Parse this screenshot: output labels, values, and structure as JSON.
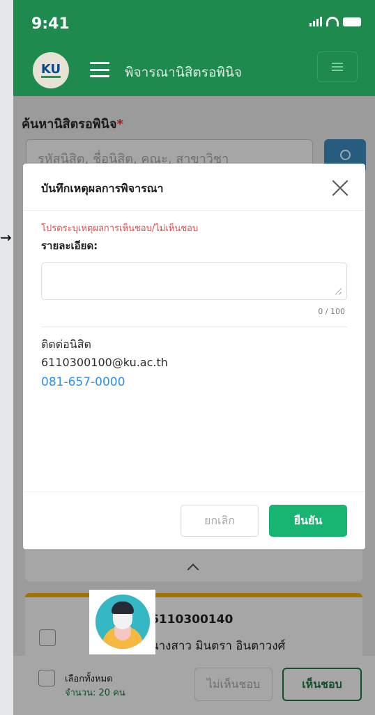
{
  "status_bar": {
    "time": "9:41"
  },
  "app_bar": {
    "logo_text": "KU",
    "title": "พิจารณานิสิตรอพินิจ"
  },
  "search": {
    "label": "ค้นหานิสิตรอพินิจ",
    "required_mark": "*",
    "placeholder": "รหัสนิสิต, ชื่อนิสิต, คณะ, สาขาวิชา"
  },
  "student": {
    "id": "6110300140",
    "name": "นางสาว มินตรา อินตาวงศ์"
  },
  "bottom_bar": {
    "select_all": "เลือกทั้งหมด",
    "count": "จำนวน: 20 คน",
    "reject_label": "ไม่เห็นชอบ",
    "accept_label": "เห็นชอบ"
  },
  "modal": {
    "title": "บันทึกเหตุผลการพิจารณา",
    "hint": "โปรดระบุเหตุผลการเห็นชอบ/ไม่เห็นชอบ",
    "detail_label": "รายละเอียด:",
    "char_count": "0 / 100",
    "contact_label": "ติดต่อนิสิต",
    "email": "6110300100@ku.ac.th",
    "phone": "081-657-0000",
    "cancel_label": "ยกเลิก",
    "confirm_label": "ยืนยัน"
  },
  "outer": {
    "arrow": "→"
  }
}
